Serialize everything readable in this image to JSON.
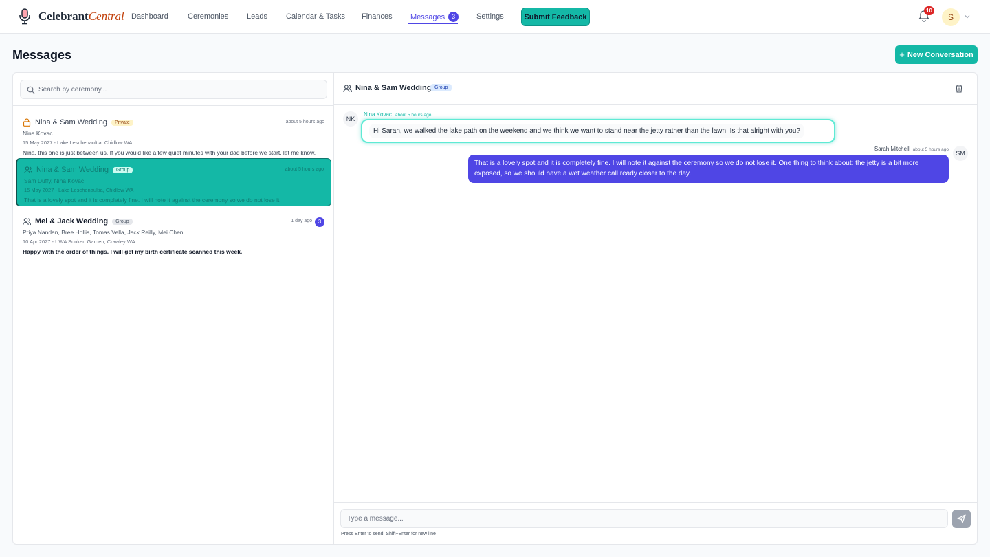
{
  "app": {
    "name_main": "Celebrant",
    "name_accent": "Central"
  },
  "nav": {
    "items": [
      {
        "label": "Dashboard"
      },
      {
        "label": "Ceremonies"
      },
      {
        "label": "Leads"
      },
      {
        "label": "Calendar & Tasks"
      },
      {
        "label": "Finances"
      },
      {
        "label": "Messages",
        "badge": "3",
        "active": true
      },
      {
        "label": "Settings"
      }
    ],
    "feedback_label": "Submit Feedback",
    "notification_count": "10",
    "avatar_initial": "S"
  },
  "page": {
    "title": "Messages",
    "new_conversation_label": "New Conversation"
  },
  "search": {
    "placeholder": "Search by ceremony...",
    "value": ""
  },
  "conversations": [
    {
      "title": "Nina & Sam Wedding",
      "tag": "Private",
      "icon": "lock-icon",
      "time": "about 5 hours ago",
      "members": "Nina Kovac",
      "meta": "15 May 2027 - Lake Leschenaultia, Chidlow WA",
      "preview": "Nina, this one is just between us. If you would like a few quiet minutes with your dad before we start, let me know."
    },
    {
      "title": "Nina & Sam Wedding",
      "tag": "Group",
      "icon": "users-icon",
      "time": "about 5 hours ago",
      "members": "Sam Duffy, Nina Kovac",
      "meta": "15 May 2027 - Lake Leschenaultia, Chidlow WA",
      "preview": "That is a lovely spot and it is completely fine. I will note it against the ceremony so we do not lose it.",
      "selected": true
    },
    {
      "title": "Mei & Jack Wedding",
      "tag": "Group",
      "icon": "users-icon",
      "time": "1 day ago",
      "badge": "3",
      "members": "Priya Nandan, Bree Hollis, Tomas Vella, Jack Reilly, Mei Chen",
      "meta": "10 Apr 2027 - UWA Sunken Garden, Crawley WA",
      "preview": "Happy with the order of things. I will get my birth certificate scanned this week.",
      "unread": true
    }
  ],
  "chat": {
    "title": "Nina & Sam Wedding",
    "tag": "Group",
    "messages": [
      {
        "direction": "in",
        "initials": "NK",
        "sender": "Nina Kovac",
        "time": "about 5 hours ago",
        "text": "Hi Sarah, we walked the lake path on the weekend and we think we want to stand near the jetty rather than the lawn. Is that alright with you?"
      },
      {
        "direction": "out",
        "initials": "SM",
        "sender": "Sarah Mitchell",
        "time": "about 5 hours ago",
        "text": "That is a lovely spot and it is completely fine. I will note it against the ceremony so we do not lose it. One thing to think about: the jetty is a bit more exposed, so we should have a wet weather call ready closer to the day."
      }
    ]
  },
  "composer": {
    "placeholder": "Type a message...",
    "value": "",
    "hint": "Press Enter to send, Shift+Enter for new line"
  },
  "colors": {
    "accent": "#14b8a6",
    "primary": "#4f46e5",
    "danger": "#dc2626"
  }
}
